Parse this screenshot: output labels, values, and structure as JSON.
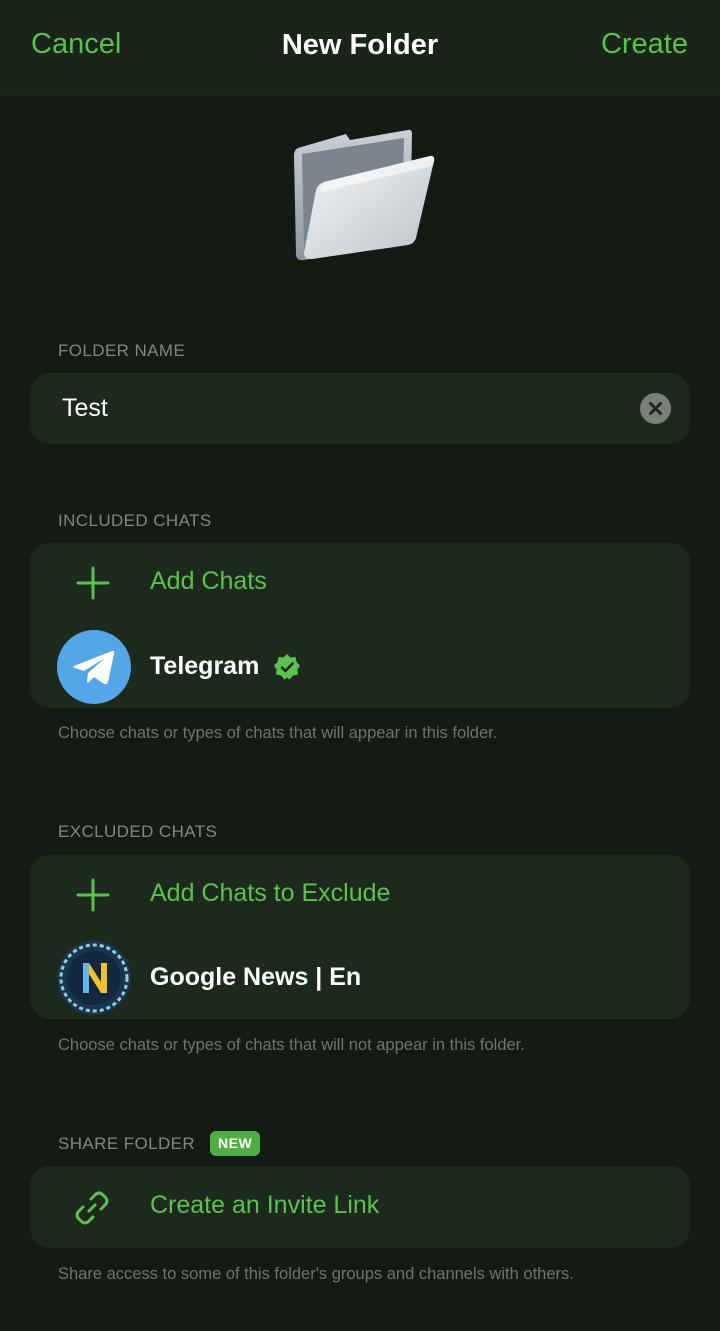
{
  "navbar": {
    "cancel_label": "Cancel",
    "title": "New Folder",
    "create_label": "Create"
  },
  "folder_name": {
    "header": "FOLDER NAME",
    "value": "Test"
  },
  "included": {
    "header": "INCLUDED CHATS",
    "add_label": "Add Chats",
    "chats": [
      {
        "name": "Telegram",
        "verified": true
      }
    ],
    "footer": "Choose chats or types of chats that will appear in this folder."
  },
  "excluded": {
    "header": "EXCLUDED CHATS",
    "add_label": "Add Chats to Exclude",
    "chats": [
      {
        "name": "Google News | En",
        "avatar_letter": "N"
      }
    ],
    "footer": "Choose chats or types of chats that will not appear in this folder."
  },
  "share": {
    "header": "SHARE FOLDER",
    "badge": "NEW",
    "link_label": "Create an Invite Link",
    "footer": "Share access to some of this folder's groups and channels with others."
  },
  "colors": {
    "accent": "#5cc24e",
    "background": "#141a14",
    "card": "#1d291c",
    "telegram_blue": "#54a7e7"
  }
}
